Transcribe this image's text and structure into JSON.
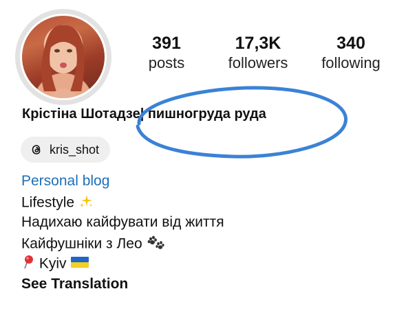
{
  "stats": {
    "posts": {
      "value": "391",
      "label": "posts"
    },
    "followers": {
      "value": "17,3K",
      "label": "followers"
    },
    "following": {
      "value": "340",
      "label": "following"
    }
  },
  "profile": {
    "display_name": "Крістіна Шотадзе| пишногруда руда",
    "threads_handle": "kris_shot",
    "category": "Personal blog",
    "bio": {
      "line1": "Lifestyle",
      "line2": "Надихаю кайфувати від життя",
      "line3": "Кайфушніки з Лео",
      "line4": "Kyiv"
    },
    "see_translation": "See Translation"
  },
  "icons": {
    "threads": "threads-icon",
    "sparkles": "sparkles-icon",
    "paw": "paw-prints-icon",
    "pin": "round-pushpin-icon",
    "flag": "ukraine-flag-icon"
  },
  "colors": {
    "link_blue": "#1d6fb8",
    "annotation_blue": "#3b82d6",
    "sparkle_yellow": "#f5c518",
    "pill_bg": "#efefef"
  }
}
